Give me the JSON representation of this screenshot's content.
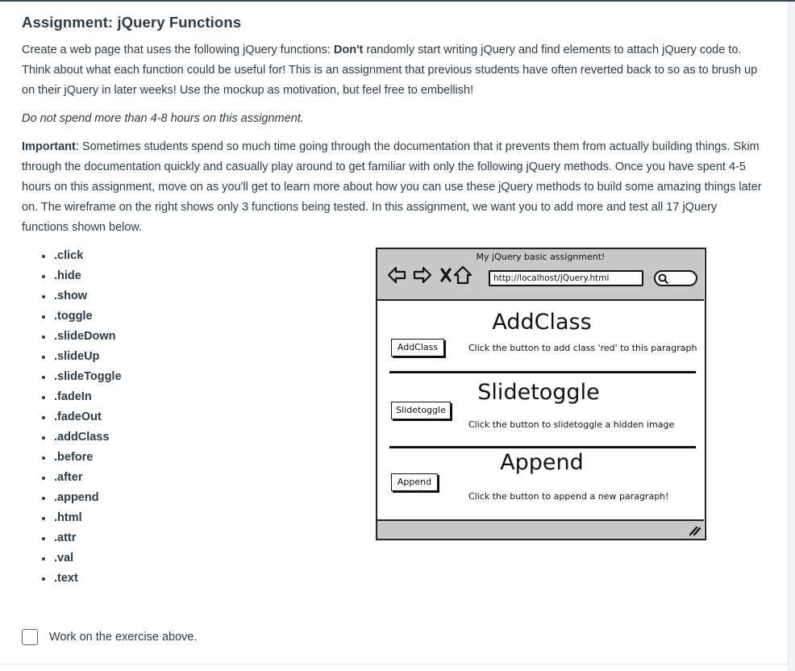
{
  "assignment": {
    "title": "Assignment: jQuery Functions",
    "intro_before": "Create a web page that uses the following jQuery functions: ",
    "intro_bold": "Don't",
    "intro_after": " randomly start writing jQuery and find elements to attach jQuery code to. Think about what each function could be useful for! This is an assignment that previous students have often reverted back to so as to brush up on their jQuery in later weeks! Use the mockup as motivation, but feel free to embellish!",
    "time_note": "Do not spend more than 4-8 hours on this assignment.",
    "important_label": "Important",
    "important_text": ": Sometimes students spend so much time going through the documentation that it prevents them from actually building things. Skim through the documentation quickly and casually play around to get familiar with only the following jQuery methods. Once you have spent 4-5 hours on this assignment, move on as you'll get to learn more about how you can use these jQuery methods to build some amazing things later on.  The wireframe on the right shows only 3 functions being tested.  In this assignment, we want you to add more and test all 17 jQuery functions shown below."
  },
  "functions": [
    ".click",
    ".hide",
    ".show",
    ".toggle",
    ".slideDown",
    ".slideUp",
    ".slideToggle",
    ".fadeIn",
    ".fadeOut",
    ".addClass",
    ".before",
    ".after",
    ".append",
    ".html",
    ".attr",
    ".val",
    ".text"
  ],
  "wireframe": {
    "window_title": "My jQuery basic assignment!",
    "url": "http://localhost/jQuery.html",
    "sections": [
      {
        "title": "AddClass",
        "button": "AddClass",
        "text": "Click the button to add class 'red' to this paragraph"
      },
      {
        "title": "Slidetoggle",
        "button": "Slidetoggle",
        "text": "Click the button to slidetoggle a hidden image"
      },
      {
        "title": "Append",
        "button": "Append",
        "text": "Click the button to append a new paragraph!"
      }
    ]
  },
  "todo": {
    "label": "Work on the exercise above.",
    "checked": false
  }
}
